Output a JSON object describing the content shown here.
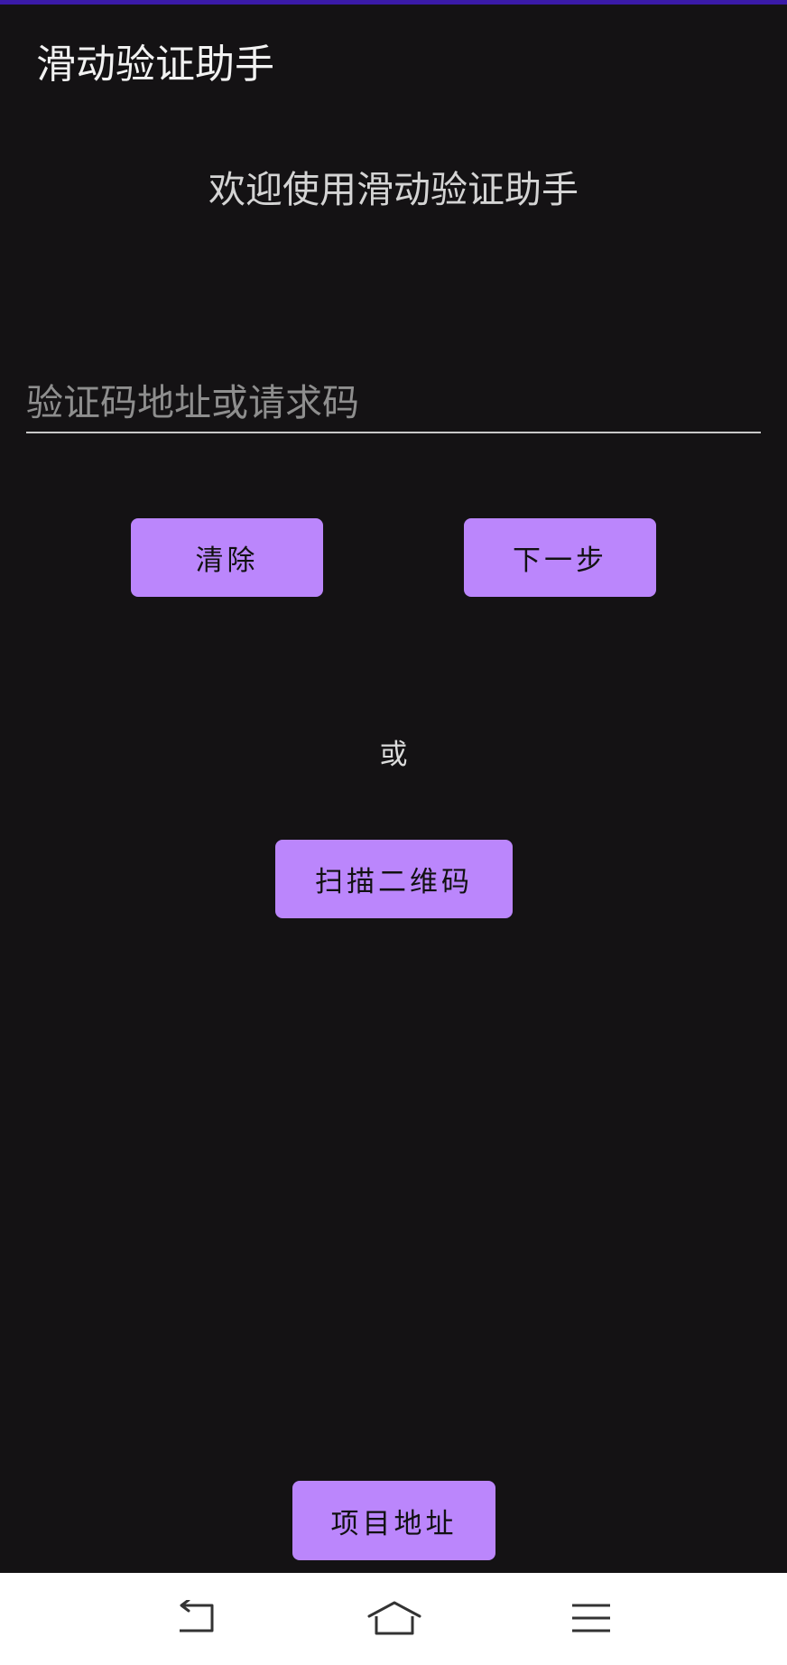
{
  "app": {
    "title": "滑动验证助手"
  },
  "main": {
    "welcome": "欢迎使用滑动验证助手",
    "url_input": {
      "value": "",
      "placeholder": "验证码地址或请求码"
    },
    "clear_label": "清除",
    "next_label": "下一步",
    "or_label": "或",
    "scan_label": "扫描二维码",
    "project_label": "项目地址"
  },
  "nav": {
    "back_icon": "back-icon",
    "home_icon": "home-icon",
    "menu_icon": "menu-icon"
  },
  "colors": {
    "background": "#141214",
    "accent": "#bb86fc",
    "status_strip": "#3a1aa8"
  }
}
